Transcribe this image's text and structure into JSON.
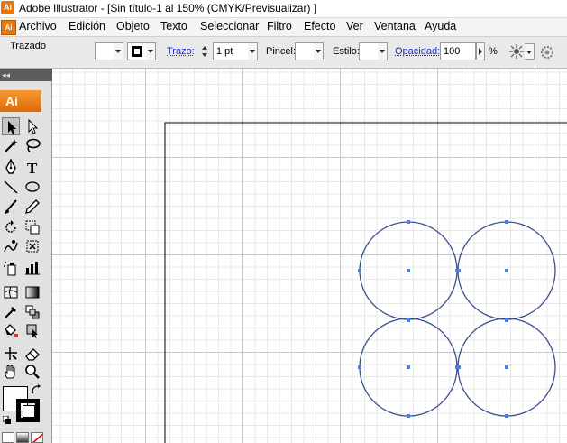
{
  "window": {
    "title": "Adobe Illustrator - [Sin título-1 al 150% (CMYK/Previsualizar) ]",
    "app_icon": "Ai"
  },
  "menubar": {
    "app_icon": "Ai",
    "items": [
      "Archivo",
      "Edición",
      "Objeto",
      "Texto",
      "Seleccionar",
      "Filtro",
      "Efecto",
      "Ver",
      "Ventana",
      "Ayuda"
    ]
  },
  "controlbar": {
    "selection_label": "Trazado",
    "stroke_label": "Trazo:",
    "stroke_weight": "1 pt",
    "brush_label": "Pincel:",
    "style_label": "Estilo:",
    "opacity_label": "Opacidad:",
    "opacity_value": "100",
    "opacity_unit": "%"
  },
  "tools_panel": {
    "logo": "Ai"
  },
  "colors": {
    "accent": "#e8760f",
    "path": "#3a4f8c",
    "anchor": "#4d7fe0",
    "grid": "#c8c8c8"
  },
  "canvas": {
    "circles": 4,
    "artboard_visible": true
  }
}
